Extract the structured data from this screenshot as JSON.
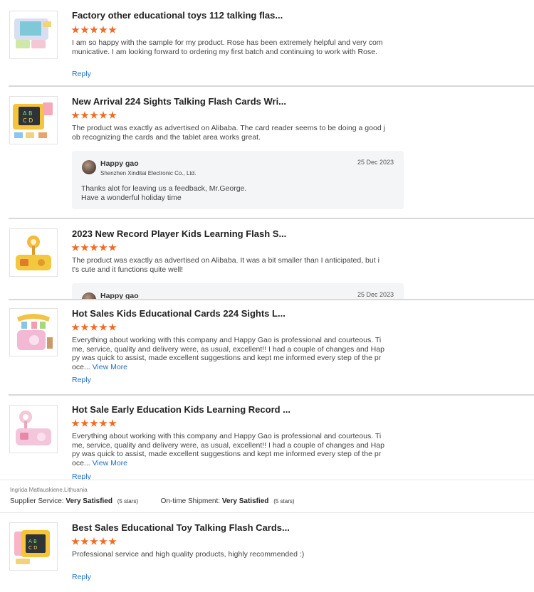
{
  "reviews": [
    {
      "title": "Factory other educational toys 112 talking flas...",
      "rating": 5,
      "text": "I am so happy with the sample for my product. Rose has been extremely helpful and very communicative. I am looking forward to ordering my first batch and continuing to work with Rose.",
      "reply_label": "Reply"
    },
    {
      "title": "New Arrival 224 Sights Talking Flash Cards Wri...",
      "rating": 5,
      "text": "The product was exactly as advertised on Alibaba. The card reader seems to be doing a good job recognizing the cards and the tablet area works great.",
      "seller_reply": {
        "name": "Happy gao",
        "company": "Shenzhen Xinditai Electronic Co., Ltd.",
        "date": "25 Dec 2023",
        "message_line1": "Thanks alot for leaving us a feedback, Mr.George.",
        "message_line2": "Have a wonderful holiday time"
      }
    },
    {
      "title": "2023 New Record Player Kids Learning Flash S...",
      "rating": 5,
      "text": "The product was exactly as advertised on Alibaba. It was a bit smaller than I anticipated, but it's cute and it functions quite well!",
      "seller_reply": {
        "name": "Happy gao",
        "date": "25 Dec 2023"
      }
    },
    {
      "title": "Hot Sales Kids Educational Cards 224 Sights L...",
      "rating": 5,
      "text": "Everything about working with this company and Happy Gao is professional and courteous. Time, service, quality and delivery were, as usual, excellent!! I had a couple of changes and Happy was quick to assist, made excellent suggestions and kept me informed every step of the proce...",
      "view_more": "View More",
      "reply_label": "Reply"
    },
    {
      "title": "Hot Sale Early Education Kids Learning Record ...",
      "rating": 5,
      "text": "Everything about working with this company and Happy Gao is professional and courteous. Time, service, quality and delivery were, as usual, excellent!! I had a couple of changes and Happy was quick to assist, made excellent suggestions and kept me informed every step of the proce...",
      "view_more": "View More",
      "reply_label": "Reply"
    },
    {
      "title": "Best Sales Educational Toy Talking Flash Cards...",
      "rating": 5,
      "text": "Professional service and high quality products, highly recommended :)",
      "reply_label": "Reply"
    }
  ],
  "buyer": {
    "name_location": "Ingrida Matlauskiene,Lithuania",
    "supplier_service_label": "Supplier Service:",
    "supplier_service_value": "Very Satisfied",
    "supplier_service_stars": "(5 stars)",
    "shipment_label": "On-time Shipment:",
    "shipment_value": "Very Satisfied",
    "shipment_stars": "(5 stars)"
  },
  "colors": {
    "star": "#f06b23",
    "link": "#1f6fc5",
    "reply_bg": "#f4f5f7"
  },
  "icons": [
    "star-icon",
    "avatar"
  ]
}
